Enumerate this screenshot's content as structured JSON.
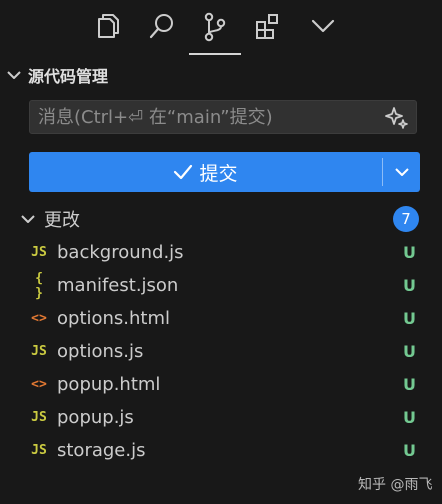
{
  "viewbar": {
    "items": [
      {
        "icon": "files-icon"
      },
      {
        "icon": "search-icon"
      },
      {
        "icon": "source-control-icon"
      },
      {
        "icon": "extensions-icon"
      },
      {
        "icon": "chevron-down-icon"
      }
    ]
  },
  "section": {
    "title": "源代码管理"
  },
  "commit": {
    "placeholder": "消息(Ctrl+⏎ 在“main”提交)",
    "button_label": "提交",
    "accent": "#2f86f0"
  },
  "changes": {
    "label": "更改",
    "count": "7",
    "files": [
      {
        "name": "background.js",
        "icon": "JS",
        "icon_color": "#cbcb41",
        "status": "U"
      },
      {
        "name": "manifest.json",
        "icon": "{ }",
        "icon_color": "#cbcb41",
        "status": "U"
      },
      {
        "name": "options.html",
        "icon": "<>",
        "icon_color": "#e37933",
        "status": "U"
      },
      {
        "name": "options.js",
        "icon": "JS",
        "icon_color": "#cbcb41",
        "status": "U"
      },
      {
        "name": "popup.html",
        "icon": "<>",
        "icon_color": "#e37933",
        "status": "U"
      },
      {
        "name": "popup.js",
        "icon": "JS",
        "icon_color": "#cbcb41",
        "status": "U"
      },
      {
        "name": "storage.js",
        "icon": "JS",
        "icon_color": "#cbcb41",
        "status": "U"
      }
    ]
  },
  "watermark": "知乎 @雨飞"
}
